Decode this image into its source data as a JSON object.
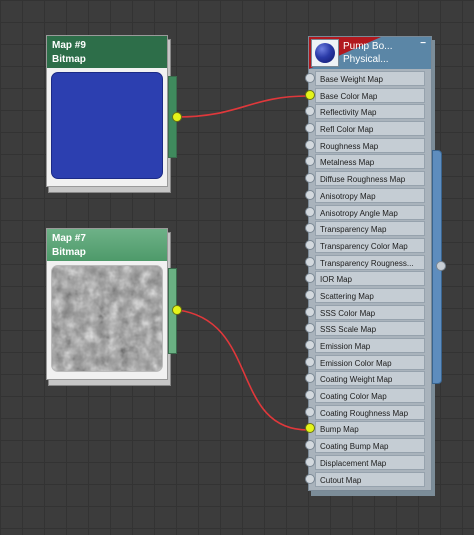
{
  "nodes": {
    "map9": {
      "title": "Map #9",
      "type": "Bitmap",
      "thumbnail": "solid-blue",
      "color": "#2c3fb0"
    },
    "map7": {
      "title": "Map #7",
      "type": "Bitmap",
      "thumbnail": "noise-texture"
    },
    "material": {
      "title": "Pump Bo...",
      "subtitle": "Physical...",
      "collapse_label": "−",
      "swatch": "blue-sphere",
      "slots": [
        {
          "label": "Base Weight Map",
          "connected": false
        },
        {
          "label": "Base Color Map",
          "connected": true
        },
        {
          "label": "Reflectivity Map",
          "connected": false
        },
        {
          "label": "Refl Color Map",
          "connected": false
        },
        {
          "label": "Roughness Map",
          "connected": false
        },
        {
          "label": "Metalness Map",
          "connected": false
        },
        {
          "label": "Diffuse Roughness Map",
          "connected": false
        },
        {
          "label": "Anisotropy Map",
          "connected": false
        },
        {
          "label": "Anisotropy Angle Map",
          "connected": false
        },
        {
          "label": "Transparency Map",
          "connected": false
        },
        {
          "label": "Transparency Color Map",
          "connected": false
        },
        {
          "label": "Transparency Rougness...",
          "connected": false
        },
        {
          "label": "IOR Map",
          "connected": false
        },
        {
          "label": "Scattering Map",
          "connected": false
        },
        {
          "label": "SSS Color Map",
          "connected": false
        },
        {
          "label": "SSS Scale Map",
          "connected": false
        },
        {
          "label": "Emission Map",
          "connected": false
        },
        {
          "label": "Emission Color Map",
          "connected": false
        },
        {
          "label": "Coating Weight Map",
          "connected": false
        },
        {
          "label": "Coating Color Map",
          "connected": false
        },
        {
          "label": "Coating Roughness Map",
          "connected": false
        },
        {
          "label": "Bump Map",
          "connected": true
        },
        {
          "label": "Coating Bump Map",
          "connected": false
        },
        {
          "label": "Displacement Map",
          "connected": false
        },
        {
          "label": "Cutout Map",
          "connected": false
        }
      ]
    }
  },
  "connections": [
    {
      "from": "Map #9",
      "to": "Base Color Map"
    },
    {
      "from": "Map #7",
      "to": "Bump Map"
    }
  ],
  "colors": {
    "wire": "#e0383b",
    "socket_active": "#e4f41a",
    "node_dark_green": "#2d6e49",
    "node_light_green": "#5fa77a",
    "material_header": "#5b86a6"
  }
}
